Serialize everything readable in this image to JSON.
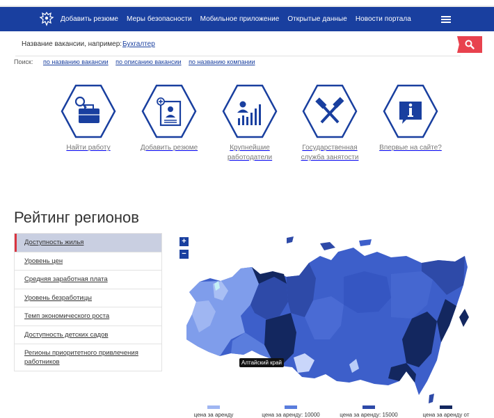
{
  "nav": {
    "links": [
      "Добавить резюме",
      "Меры безопасности",
      "Мобильное приложение",
      "Открытые данные",
      "Новости портала"
    ],
    "menu_icon": "hamburger-icon",
    "emblem_icon": "double-headed-eagle-icon",
    "bg_color": "#193f9f"
  },
  "search": {
    "label": "Название вакансии, например:",
    "example": "Бухгалтер",
    "button_icon": "search-icon",
    "button_color": "#e8424e"
  },
  "criteria": {
    "label": "Поиск:",
    "options": [
      "по названию вакансии",
      "по описанию вакансии",
      "по названию компании"
    ]
  },
  "services": [
    {
      "label": "Найти работу",
      "icon": "briefcase-search-icon"
    },
    {
      "label": "Добавить резюме",
      "icon": "add-resume-icon"
    },
    {
      "label": "Крупнейшие работодатели",
      "icon": "employer-chart-icon"
    },
    {
      "label": "Государственная служба занятости",
      "icon": "hammers-icon"
    },
    {
      "label": "Впервые на сайте?",
      "icon": "info-icon"
    }
  ],
  "rating": {
    "title": "Рейтинг регионов",
    "tabs": [
      "Доступность жилья",
      "Уровень цен",
      "Средняя заработная плата",
      "Уровень безработицы",
      "Темп экономического роста",
      "Доступность детских садов",
      "Регионы приоритетного привлечения работников"
    ],
    "active_tab": 0,
    "zoom_in": "+",
    "zoom_out": "−",
    "tooltip": "Алтайский край",
    "legend": [
      {
        "label": "цена за аренду",
        "color": "#9fb6f2"
      },
      {
        "label": "цена за аренду: 10000",
        "color": "#5a7ddd"
      },
      {
        "label": "цена за аренду: 15000",
        "color": "#2e4aa8"
      },
      {
        "label": "цена за аренду от",
        "color": "#13275f"
      }
    ]
  }
}
